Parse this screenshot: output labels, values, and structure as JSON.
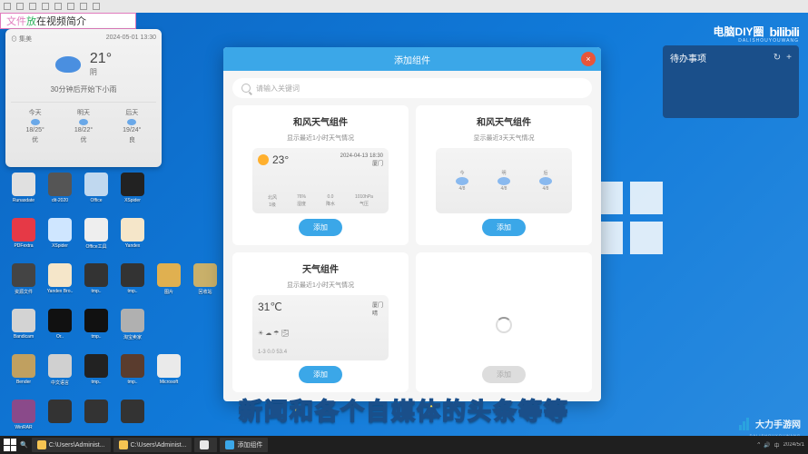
{
  "banner": {
    "w1": "文件",
    "w2": "放",
    "w3": "在视频简介"
  },
  "brand": {
    "name": "电脑DIY圈",
    "logo": "bilibili",
    "sub": "DALISHOUYOUWANG"
  },
  "watermark": {
    "name": "大力手游网",
    "sub": "DALISHOUYOUWANG"
  },
  "todo": {
    "title": "待办事项",
    "add": "+",
    "refresh": "↻"
  },
  "weather": {
    "loc_icon": "⊙",
    "loc": "集美",
    "datetime": "2024-05-01 13:30",
    "temp": "21°",
    "cond": "阴",
    "tip": "30分钟后开始下小雨",
    "days": [
      {
        "name": "今天",
        "range": "18/25°",
        "q": "优"
      },
      {
        "name": "明天",
        "range": "18/22°",
        "q": "优"
      },
      {
        "name": "后天",
        "range": "19/24°",
        "q": "良"
      }
    ]
  },
  "desktop_icons": [
    {
      "label": "Runasdate",
      "bg": "#e0e0e0"
    },
    {
      "label": "dit-2020",
      "bg": "#555"
    },
    {
      "label": "Office",
      "bg": "#c0d8ef"
    },
    {
      "label": "XSpider",
      "bg": "#222"
    },
    {
      "label": "",
      "bg": "transparent"
    },
    {
      "label": "",
      "bg": "transparent"
    },
    {
      "label": "PDFextra",
      "bg": "#e63946"
    },
    {
      "label": "XSpider",
      "bg": "#cfe6ff"
    },
    {
      "label": "Office工具",
      "bg": "#eee"
    },
    {
      "label": "Yandex",
      "bg": "#f5e6c9"
    },
    {
      "label": "",
      "bg": "transparent"
    },
    {
      "label": "",
      "bg": "transparent"
    },
    {
      "label": "资源文件",
      "bg": "#444"
    },
    {
      "label": "Yandex Bro..",
      "bg": "#f5e6c9"
    },
    {
      "label": "tmp..",
      "bg": "#333"
    },
    {
      "label": "tmp..",
      "bg": "#333"
    },
    {
      "label": "图片",
      "bg": "#e0b050"
    },
    {
      "label": "回收站",
      "bg": "#c9b06a"
    },
    {
      "label": "Bandicam",
      "bg": "#d3d3d3"
    },
    {
      "label": "Or..",
      "bg": "#111"
    },
    {
      "label": "tmp..",
      "bg": "#111"
    },
    {
      "label": "淘宝卖家",
      "bg": "#b0b0b0"
    },
    {
      "label": "",
      "bg": "transparent"
    },
    {
      "label": "",
      "bg": "transparent"
    },
    {
      "label": "Bender",
      "bg": "#c0a060"
    },
    {
      "label": "中文语言",
      "bg": "#d0d0d0"
    },
    {
      "label": "tmp..",
      "bg": "#222"
    },
    {
      "label": "tmp..",
      "bg": "#5a3c2e"
    },
    {
      "label": "Microsoft",
      "bg": "#eaeaea"
    },
    {
      "label": "",
      "bg": "transparent"
    },
    {
      "label": "WinRAR",
      "bg": "#8a4a8a"
    },
    {
      "label": "",
      "bg": "#333"
    },
    {
      "label": "",
      "bg": "#333"
    },
    {
      "label": "",
      "bg": "#333"
    },
    {
      "label": "",
      "bg": "transparent"
    },
    {
      "label": "",
      "bg": "transparent"
    }
  ],
  "dialog": {
    "title": "添加组件",
    "close": "×",
    "search_placeholder": "请输入关键词",
    "cards": [
      {
        "title": "和风天气组件",
        "sub": "显示最近1小时天气情况",
        "btn": "添加",
        "preview": {
          "temp": "23°",
          "cond": "☀",
          "date": "2024-04-13 18:30",
          "loc": "厦门",
          "metrics": [
            [
              "北风",
              "1级"
            ],
            [
              "76%",
              "湿度"
            ],
            [
              "0.0",
              "降水"
            ],
            [
              "1010hPa",
              "气压"
            ]
          ]
        }
      },
      {
        "title": "和风天气组件",
        "sub": "显示最近3天天气情况",
        "btn": "添加",
        "preview": {
          "days": [
            [
              "今",
              "☁",
              "4/8"
            ],
            [
              "明",
              "☁",
              "4/8"
            ],
            [
              "后",
              "☁",
              "4/8"
            ]
          ]
        }
      },
      {
        "title": "天气组件",
        "sub": "显示最近1小时天气情况",
        "btn": "添加",
        "preview": {
          "temp": "31℃",
          "cond": "晴",
          "loc": "厦门",
          "icons": "☀ ☁ ☂ 🌫",
          "range": "1-3  0.0  53.4"
        }
      },
      {
        "title": "",
        "sub": "",
        "btn": "添加",
        "loading": true
      }
    ]
  },
  "subtitle": "新闻和各个自媒体的头条等等",
  "taskbar": {
    "search": "🔍",
    "tasks": [
      {
        "label": "C:\\Users\\Administ...",
        "ico": "#f6c452"
      },
      {
        "label": "C:\\Users\\Administ...",
        "ico": "#f6c452"
      },
      {
        "label": "",
        "ico": "#e8e8e8"
      },
      {
        "label": "添加组件",
        "ico": "#3ba7e8"
      }
    ],
    "tray": [
      "^",
      "🔊",
      "中"
    ],
    "date": "2024/5/1"
  }
}
